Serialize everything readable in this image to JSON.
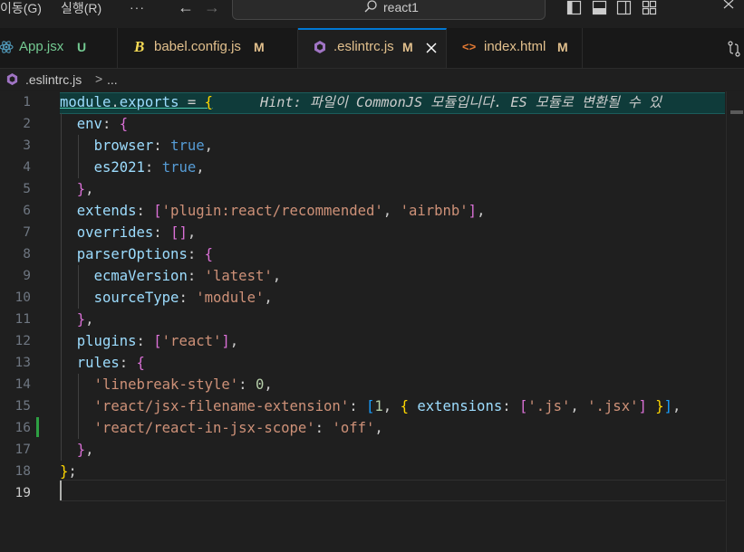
{
  "titlebar": {
    "menu_go": "이동(G)",
    "menu_run": "실행(R)",
    "more": "···",
    "back_arrow": "←",
    "forward_arrow": "→",
    "search_text": "react1"
  },
  "tabs": [
    {
      "label": "App.jsx",
      "status": "U",
      "label_color": "#73c991",
      "status_color": "#73c991",
      "icon": "react-icon"
    },
    {
      "label": "babel.config.js",
      "status": "M",
      "label_color": "#e2c08d",
      "status_color": "#e2c08d",
      "icon": "babel-icon"
    },
    {
      "label": ".eslintrc.js",
      "status": "M",
      "label_color": "#e2c08d",
      "status_color": "#e2c08d",
      "icon": "eslint-icon",
      "active": true
    },
    {
      "label": "index.html",
      "status": "M",
      "label_color": "#e2c08d",
      "status_color": "#e2c08d",
      "icon": "html-icon"
    }
  ],
  "breadcrumb": {
    "file": ".eslintrc.js",
    "separator": ">",
    "more": "..."
  },
  "hint": "Hint: 파일이 CommonJS 모듈입니다. ES 모듈로 변환될 수 있",
  "line_numbers": [
    "1",
    "2",
    "3",
    "4",
    "5",
    "6",
    "7",
    "8",
    "9",
    "10",
    "11",
    "12",
    "13",
    "14",
    "15",
    "16",
    "17",
    "18",
    "19"
  ],
  "current_line": "19",
  "colors": {
    "accent": "#0078d4",
    "modified": "#e2c08d",
    "untracked": "#73c991",
    "added_gutter": "#2ea043"
  },
  "code": {
    "l1": {
      "a": "module",
      "b": ".",
      "c": "exports",
      "d": " = ",
      "e": "{"
    },
    "l2": {
      "key": "env",
      "colon": ": ",
      "brace": "{"
    },
    "l3": {
      "key": "browser",
      "colon": ": ",
      "val": "true",
      "end": ","
    },
    "l4": {
      "key": "es2021",
      "colon": ": ",
      "val": "true",
      "end": ","
    },
    "l5": {
      "brace": "}",
      "end": ","
    },
    "l6": {
      "key": "extends",
      "colon": ": ",
      "open": "[",
      "s1": "'plugin:react/recommended'",
      "comma": ", ",
      "s2": "'airbnb'",
      "close": "]",
      "end": ","
    },
    "l7": {
      "key": "overrides",
      "colon": ": ",
      "open": "[",
      "close": "]",
      "end": ","
    },
    "l8": {
      "key": "parserOptions",
      "colon": ": ",
      "brace": "{"
    },
    "l9": {
      "key": "ecmaVersion",
      "colon": ": ",
      "val": "'latest'",
      "end": ","
    },
    "l10": {
      "key": "sourceType",
      "colon": ": ",
      "val": "'module'",
      "end": ","
    },
    "l11": {
      "brace": "}",
      "end": ","
    },
    "l12": {
      "key": "plugins",
      "colon": ": ",
      "open": "[",
      "s1": "'react'",
      "close": "]",
      "end": ","
    },
    "l13": {
      "key": "rules",
      "colon": ": ",
      "brace": "{"
    },
    "l14": {
      "key": "'linebreak-style'",
      "colon": ": ",
      "val": "0",
      "end": ","
    },
    "l15": {
      "key": "'react/jsx-filename-extension'",
      "colon": ": ",
      "open": "[",
      "num": "1",
      "comma": ", ",
      "ob": "{",
      "sp": " ",
      "ekey": "extensions",
      "ecolon": ": ",
      "aopen": "[",
      "s1": "'.js'",
      "comma2": ", ",
      "s2": "'.jsx'",
      "aclose": "]",
      "sp2": " ",
      "cb": "}",
      "close": "]",
      "end": ","
    },
    "l16": {
      "key": "'react/react-in-jsx-scope'",
      "colon": ": ",
      "val": "'off'",
      "end": ","
    },
    "l17": {
      "brace": "}",
      "end": ","
    },
    "l18": {
      "brace": "}",
      "end": ";"
    }
  }
}
